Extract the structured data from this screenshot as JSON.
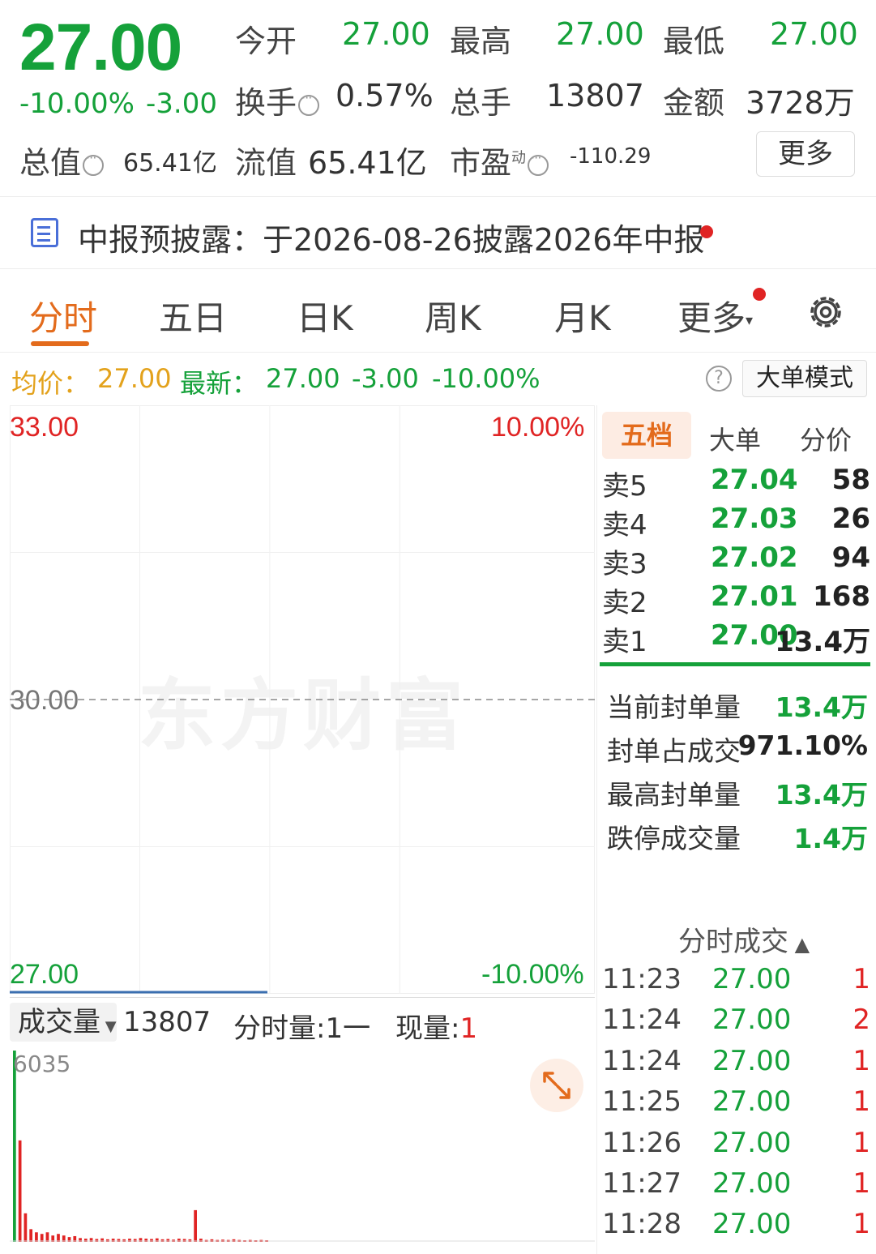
{
  "quote": {
    "price": "27.00",
    "change_pct": "-10.00%",
    "change_abs": "-3.00",
    "open_label": "今开",
    "open": "27.00",
    "high_label": "最高",
    "high": "27.00",
    "low_label": "最低",
    "low": "27.00",
    "turnover_label": "换手",
    "turnover": "0.57%",
    "volume_label": "总手",
    "volume": "13807",
    "amount_label": "金额",
    "amount": "3728万",
    "mktcap_label": "总值",
    "mktcap": "65.41亿",
    "float_label": "流值",
    "float": "65.41亿",
    "pe_label": "市盈",
    "pe_sup": "动",
    "pe": "-110.29",
    "more_label": "更多"
  },
  "notice": {
    "text": "中报预披露：于2026-08-26披露2026年中报"
  },
  "tabs": [
    "分时",
    "五日",
    "日K",
    "周K",
    "月K",
    "更多"
  ],
  "price_line": {
    "avg_label": "均价：",
    "avg": "27.00",
    "last_label": "最新：",
    "last": "27.00",
    "last_chg": "-3.00",
    "last_pct": "-10.00%",
    "help": "?",
    "big_mode": "大单模式"
  },
  "chart": {
    "y_top": "33.00",
    "y_mid": "30.00",
    "y_bottom": "27.00",
    "pct_top": "10.00%",
    "pct_bottom": "-10.00%",
    "watermark": "东方财富"
  },
  "chart_data": {
    "type": "line",
    "title": "",
    "ylim": [
      27.0,
      33.0
    ],
    "reference": 30.0,
    "series": [
      {
        "values": [
          27.0,
          27.0,
          27.0,
          27.0,
          27.0,
          27.0,
          27.0,
          27.0,
          27.0,
          27.0
        ]
      }
    ],
    "volume": {
      "max": 6035,
      "values": [
        6035,
        3200,
        900,
        400,
        300,
        250,
        300,
        200,
        250,
        200,
        150,
        180,
        120,
        100,
        120,
        90,
        110,
        80,
        100,
        90,
        80,
        100,
        90,
        120,
        100,
        90,
        110,
        80,
        90,
        70,
        100,
        90,
        80,
        1000,
        100,
        60,
        80,
        60,
        70,
        60,
        80,
        60,
        50,
        60,
        50,
        60,
        50
      ]
    }
  },
  "volume_bar": {
    "selector": "成交量",
    "total": "13807",
    "minute_label": "分时量:1",
    "minute_dash": "一",
    "now_label": "现量:",
    "now_value": "1",
    "max_label": "6035"
  },
  "right_panel": {
    "tabs": [
      "五档",
      "大单",
      "分价"
    ],
    "asks": [
      {
        "label": "卖5",
        "price": "27.04",
        "vol": "58"
      },
      {
        "label": "卖4",
        "price": "27.03",
        "vol": "26"
      },
      {
        "label": "卖3",
        "price": "27.02",
        "vol": "94"
      },
      {
        "label": "卖2",
        "price": "27.01",
        "vol": "168"
      },
      {
        "label": "卖1",
        "price": "27.00",
        "vol": "13.4万"
      }
    ],
    "seal": [
      {
        "label": "当前封单量",
        "value": "13.4万"
      },
      {
        "label": "封单占成交",
        "value": "971.10%"
      },
      {
        "label": "最高封单量",
        "value": "13.4万"
      },
      {
        "label": "跌停成交量",
        "value": "1.4万"
      }
    ],
    "ticks_title": "分时成交",
    "ticks": [
      {
        "time": "11:23",
        "price": "27.00",
        "qty": "1"
      },
      {
        "time": "11:24",
        "price": "27.00",
        "qty": "2"
      },
      {
        "time": "11:24",
        "price": "27.00",
        "qty": "1"
      },
      {
        "time": "11:25",
        "price": "27.00",
        "qty": "1"
      },
      {
        "time": "11:26",
        "price": "27.00",
        "qty": "1"
      },
      {
        "time": "11:27",
        "price": "27.00",
        "qty": "1"
      },
      {
        "time": "11:28",
        "price": "27.00",
        "qty": "1"
      }
    ]
  }
}
